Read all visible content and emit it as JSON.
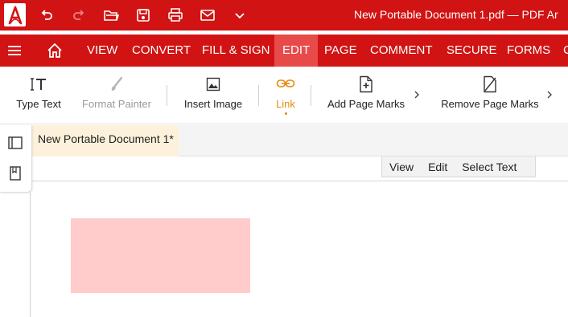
{
  "titlebar": {
    "app_logo": "A",
    "quick_access": [
      "undo-icon",
      "redo-icon",
      "open-folder-icon",
      "save-icon",
      "print-icon",
      "email-icon",
      "chevron-down-icon"
    ],
    "doc_title": "New Portable Document 1.pdf  —  PDF Ar"
  },
  "ribbon": {
    "tabs": [
      {
        "label": "VIEW"
      },
      {
        "label": "CONVERT"
      },
      {
        "label": "FILL & SIGN"
      },
      {
        "label": "EDIT",
        "active": true
      },
      {
        "label": "PAGE"
      },
      {
        "label": "COMMENT"
      },
      {
        "label": "SECURE"
      },
      {
        "label": "FORMS"
      },
      {
        "label": "C"
      }
    ]
  },
  "toolbar": {
    "type_text": "Type Text",
    "format_painter": "Format Painter",
    "insert_image": "Insert Image",
    "link": "Link",
    "add_page_marks": "Add Page Marks",
    "remove_page_marks": "Remove Page Marks"
  },
  "document": {
    "tab_label": "New Portable Document 1*",
    "modes": [
      "View",
      "Edit",
      "Select Text"
    ]
  },
  "colors": {
    "brand_red": "#d11313",
    "active_tab": "#e84a4a",
    "accent_orange": "#e8890c",
    "doc_tab_bg": "#fdf1db",
    "link_area": "#ffcccb"
  }
}
